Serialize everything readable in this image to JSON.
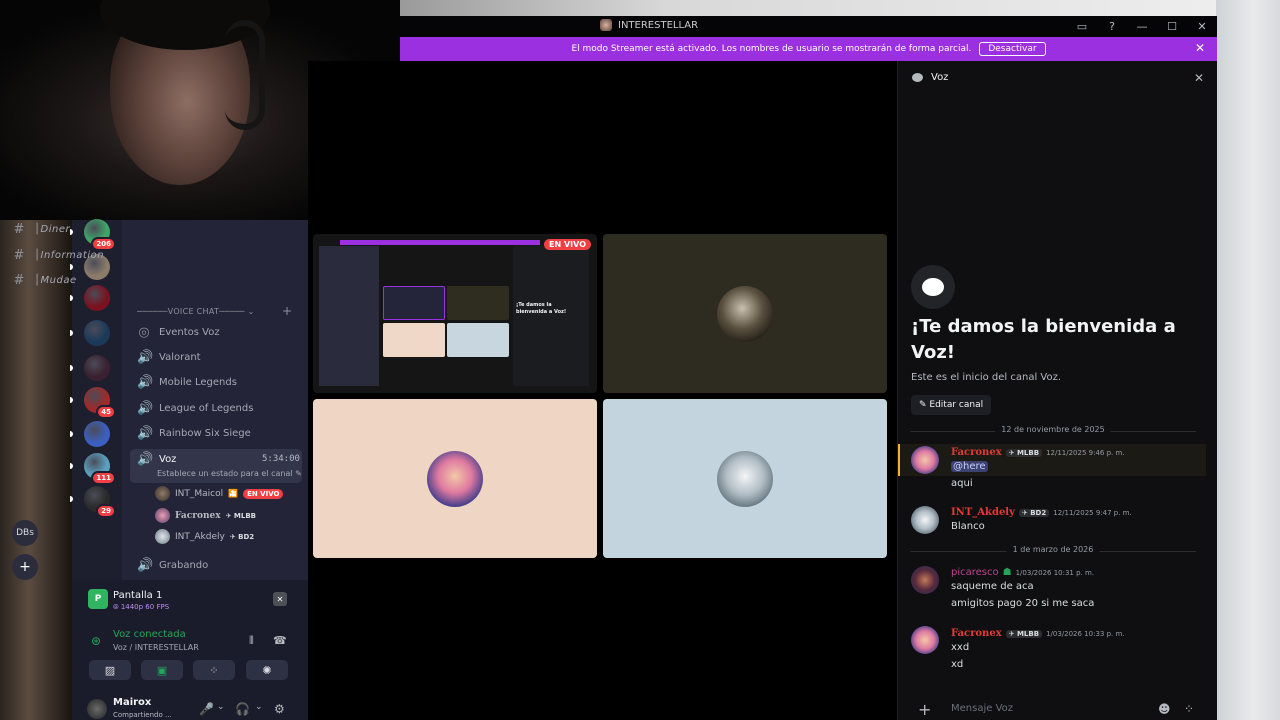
{
  "window": {
    "title": "INTERESTELLAR",
    "controls": [
      "▭",
      "?",
      "—",
      "☐",
      "✕"
    ]
  },
  "streamer_banner": {
    "text": "El modo Streamer está activado. Los nombres de usuario se mostrarán de forma parcial.",
    "button": "Desactivar",
    "close": "✕"
  },
  "servers": [
    {
      "badge": "206",
      "color": "#3fa66a"
    },
    {
      "badge": "",
      "color": "#8a7b6a"
    },
    {
      "badge": "",
      "color": "#7a1220"
    },
    {
      "badge": "",
      "color": "#1b3a5a"
    },
    {
      "badge": "",
      "color": "#3a2030"
    },
    {
      "badge": "45",
      "color": "#a02a2a"
    },
    {
      "badge": "",
      "color": "#3b5fc0"
    },
    {
      "badge": "111",
      "color": "#5aa0c0"
    },
    {
      "badge": "29",
      "color": "#2a2a2a"
    }
  ],
  "servers_extra": {
    "dbs": "DBs",
    "add": "+"
  },
  "channels": {
    "text": [
      {
        "icon": "#",
        "name": "│Diner"
      },
      {
        "icon": "#",
        "name": "│Information"
      },
      {
        "icon": "#",
        "name": "│Mudae"
      }
    ],
    "category": "──────VOICE CHAT───── ⌄",
    "category_add": "+",
    "voice": [
      {
        "icon": "◎",
        "name": "Eventos Voz"
      },
      {
        "icon": "🔊",
        "name": "Valorant"
      },
      {
        "icon": "🔊",
        "name": "Mobile Legends"
      },
      {
        "icon": "🔊",
        "name": "League of Legends"
      },
      {
        "icon": "🔊",
        "name": "Rainbow Six Siege"
      }
    ],
    "active": {
      "icon": "🔊",
      "name": "Voz",
      "time": "5:34:00",
      "status": "Establece un estado para el canal ✎"
    },
    "voice_users": [
      {
        "name": "INT_Maicol",
        "extra": "🎦",
        "live": "EN VIVO",
        "tag": ""
      },
      {
        "name": "Facronex",
        "tag": "✈ MLBB"
      },
      {
        "name": "INT_Akdely",
        "tag": "✈ BD2"
      }
    ],
    "after": {
      "icon": "🔊",
      "name": "Grabando"
    }
  },
  "screenshare": {
    "title": "Pantalla 1",
    "sub": "⦾ 1440p 60 FPS",
    "close": "✕",
    "icon": "P"
  },
  "voice_connection": {
    "status": "Voz conectada",
    "location": "Voz / INTERESTELLAR",
    "buttons": [
      "▨",
      "▣",
      "⁘",
      "✺"
    ]
  },
  "user": {
    "name": "Mairox",
    "status": "Compartiendo ...",
    "controls": [
      "🎤",
      "⌄",
      "🎧",
      "⌄",
      "⚙"
    ]
  },
  "stage": {
    "live_label": "EN VIVO",
    "mini_welcome": "¡Te damos la bienvenida a Voz!"
  },
  "chat": {
    "header": "Voz",
    "close": "✕",
    "welcome_title": "¡Te damos la bienvenida a Voz!",
    "welcome_sub": "Este es el inicio del canal Voz.",
    "edit_button": "✎ Editar canal",
    "dividers": [
      "12 de noviembre de 2025",
      "1 de marzo de 2026"
    ],
    "messages": [
      {
        "name": "Facronex",
        "tag": "✈ MLBB",
        "time": "12/11/2025 9:46 p. m.",
        "lines": [
          "@here",
          "aqui"
        ]
      },
      {
        "name": "INT_Akdely",
        "tag": "✈ BD2",
        "time": "12/11/2025 9:47 p. m.",
        "lines": [
          "Blanco"
        ]
      },
      {
        "name": "picaresco",
        "tag": "☗",
        "time": "1/03/2026 10:31 p. m.",
        "lines": [
          "saqueme de aca",
          "amigitos pago 20 si me saca"
        ]
      },
      {
        "name": "Facronex",
        "tag": "✈ MLBB",
        "time": "1/03/2026 10:33 p. m.",
        "lines": [
          "xxd",
          "xd"
        ]
      }
    ],
    "composer": {
      "plus": "+",
      "placeholder": "Mensaje Voz",
      "emoji": "☻",
      "apps": "⁘"
    }
  }
}
